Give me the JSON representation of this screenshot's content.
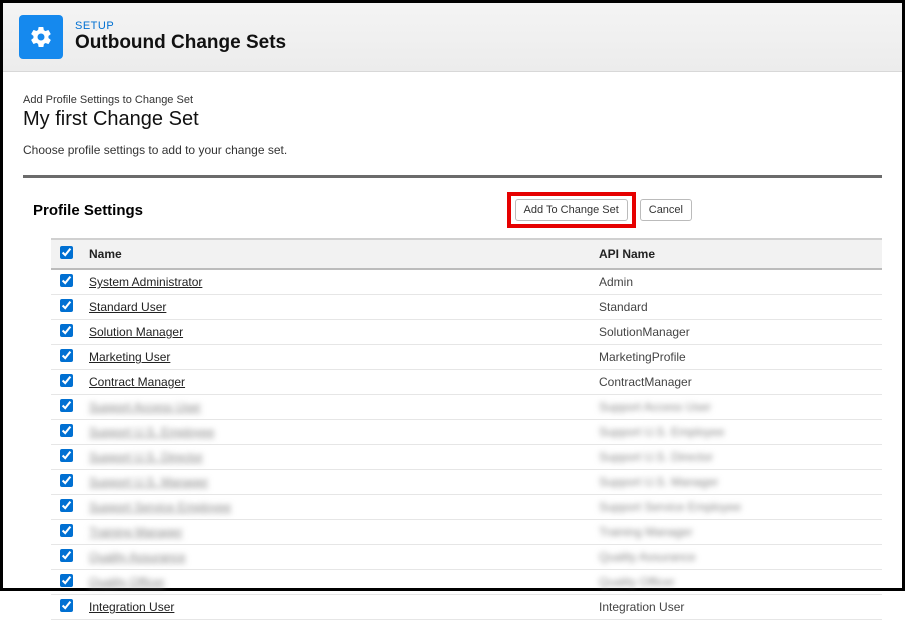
{
  "header": {
    "eyebrow": "SETUP",
    "title": "Outbound Change Sets"
  },
  "intro": {
    "small": "Add Profile Settings to Change Set",
    "big": "My first Change Set",
    "desc": "Choose profile settings to add to your change set."
  },
  "section": {
    "title": "Profile Settings",
    "btn_add": "Add To Change Set",
    "btn_cancel": "Cancel"
  },
  "table": {
    "col_name": "Name",
    "col_api": "API Name",
    "rows": [
      {
        "name": "System Administrator",
        "api": "Admin",
        "blur": false
      },
      {
        "name": "Standard User",
        "api": "Standard",
        "blur": false
      },
      {
        "name": "Solution Manager",
        "api": "SolutionManager",
        "blur": false
      },
      {
        "name": "Marketing User",
        "api": "MarketingProfile",
        "blur": false
      },
      {
        "name": "Contract Manager",
        "api": "ContractManager",
        "blur": false
      },
      {
        "name": "Support Access User",
        "api": "Support Access User",
        "blur": true
      },
      {
        "name": "Support U.S. Employee",
        "api": "Support U.S. Employee",
        "blur": true
      },
      {
        "name": "Support U.S. Director",
        "api": "Support U.S. Director",
        "blur": true
      },
      {
        "name": "Support U.S. Manager",
        "api": "Support U.S. Manager",
        "blur": true
      },
      {
        "name": "Support Service Employee",
        "api": "Support Service Employee",
        "blur": true
      },
      {
        "name": "Training Manager",
        "api": "Training Manager",
        "blur": true
      },
      {
        "name": "Quality Assurance",
        "api": "Quality Assurance",
        "blur": true
      },
      {
        "name": "Quality Officer",
        "api": "Quality Officer",
        "blur": true
      },
      {
        "name": "Integration User",
        "api": "Integration User",
        "blur": false
      }
    ]
  }
}
